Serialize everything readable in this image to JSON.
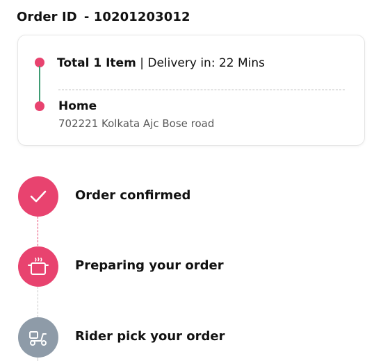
{
  "order": {
    "id_label": "Order ID",
    "id_value": "- 10201203012"
  },
  "summary": {
    "items": "Total 1 Item",
    "separator": " | ",
    "delivery": "Delivery in: 22 Mins"
  },
  "address": {
    "title": "Home",
    "line": "702221 Kolkata Ajc Bose road"
  },
  "steps": [
    {
      "label": "Order confirmed",
      "icon": "check-icon",
      "status": "done",
      "color": "#e8436f"
    },
    {
      "label": "Preparing your order",
      "icon": "cooking-pot-icon",
      "status": "active",
      "color": "#e8436f"
    },
    {
      "label": "Rider pick your order",
      "icon": "scooter-icon",
      "status": "pending",
      "color": "#8e9ba8"
    }
  ]
}
